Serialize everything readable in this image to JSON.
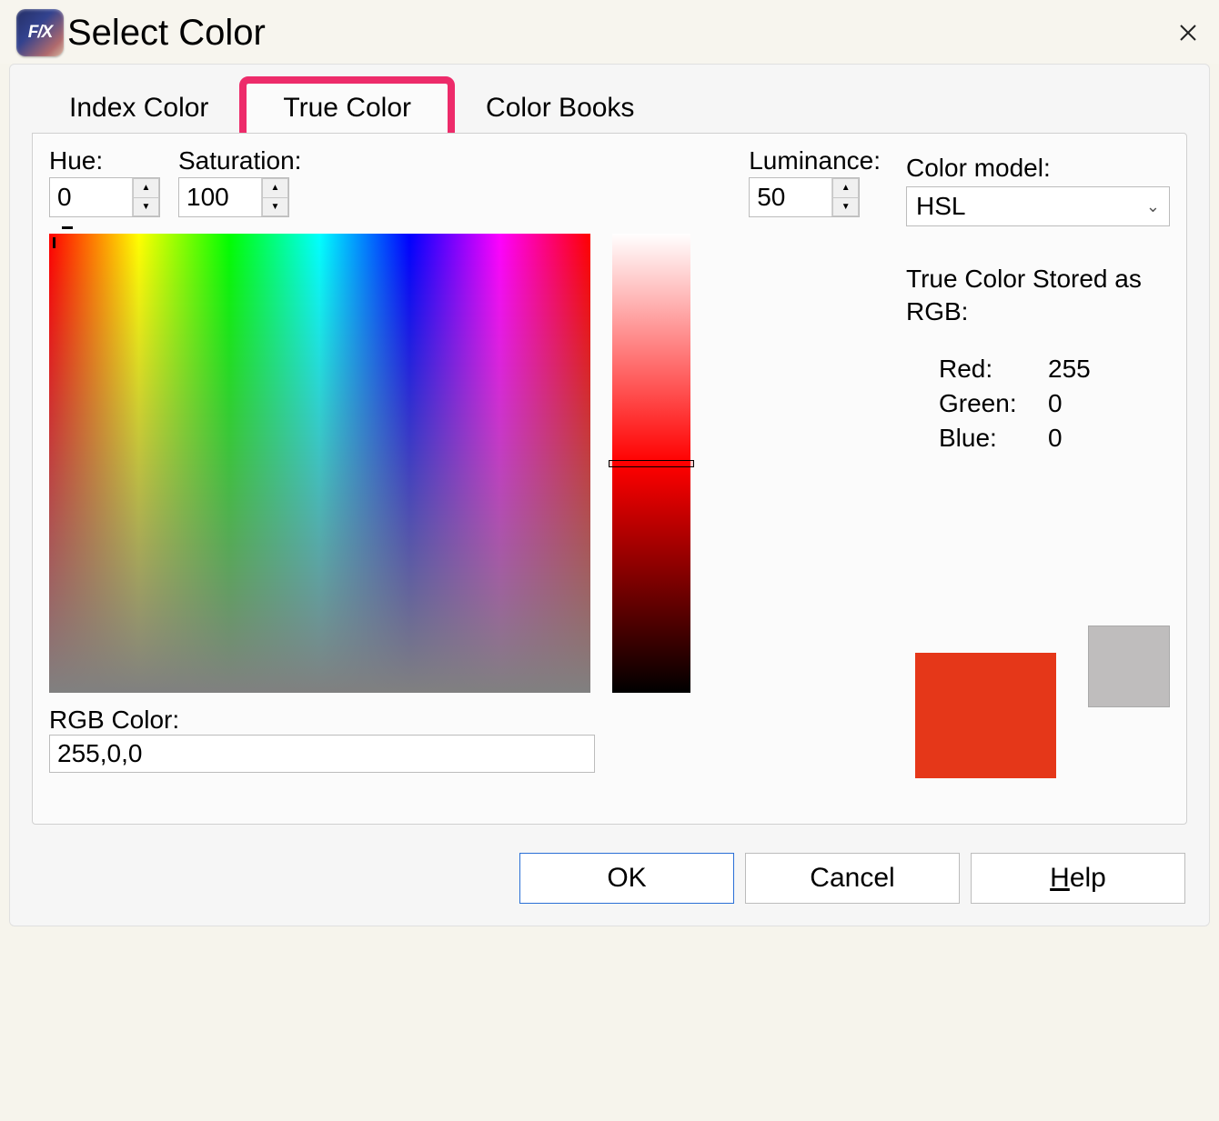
{
  "window": {
    "title": "Select Color",
    "app_icon_text": "F/X"
  },
  "tabs": {
    "index": "Index Color",
    "true": "True Color",
    "books": "Color Books"
  },
  "hsl": {
    "hue_label": "Hue:",
    "hue_value": "0",
    "sat_label": "Saturation:",
    "sat_value": "100",
    "lum_label": "Luminance:",
    "lum_value": "50"
  },
  "rgb_field": {
    "label": "RGB Color:",
    "value": "255,0,0"
  },
  "model": {
    "label": "Color model:",
    "value": "HSL"
  },
  "stored": {
    "label": "True Color Stored as RGB:",
    "red_label": "Red:",
    "red_value": "255",
    "green_label": "Green:",
    "green_value": "0",
    "blue_label": "Blue:",
    "blue_value": "0"
  },
  "swatches": {
    "current_color": "#e53719",
    "previous_color": "#bfbdbd"
  },
  "buttons": {
    "ok": "OK",
    "cancel": "Cancel",
    "help": "Help"
  },
  "highlight_color": "#ed2b6a"
}
